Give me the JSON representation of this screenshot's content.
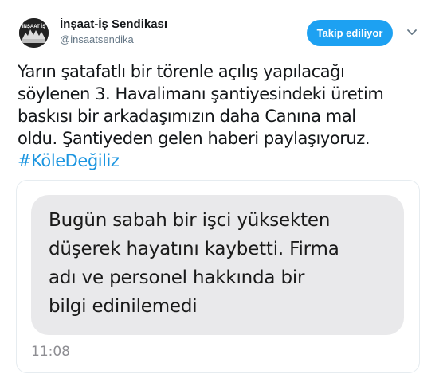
{
  "author": {
    "display_name": "İnşaat-İş Sendikası",
    "handle": "@insaatsendika",
    "avatar_label": "İNŞAAT İŞ"
  },
  "follow_button": {
    "label": "Takip ediliyor",
    "color": "#1da1f2"
  },
  "menu_icon": "chevron-down-icon",
  "tweet": {
    "lines": [
      "Yarın şatafatlı bir törenle açılış yapılacağı",
      "söylenen 3. Havalimanı şantiyesindeki üretim",
      "baskısı bir arkadaşımızın daha Canına mal",
      "oldu. Şantiyeden gelen haberi paylaşıyoruz."
    ],
    "hashtag": "#KöleDeğiliz",
    "hashtag_color": "#1b95e0"
  },
  "media": {
    "message_lines": [
      "Bugün sabah bir işci yüksekten",
      "düşerek hayatını kaybetti. Firma",
      "adı ve personel hakkında bir",
      "bilgi edinilemedi"
    ],
    "time": "11:08",
    "bubble_color": "#e9e9eb"
  }
}
